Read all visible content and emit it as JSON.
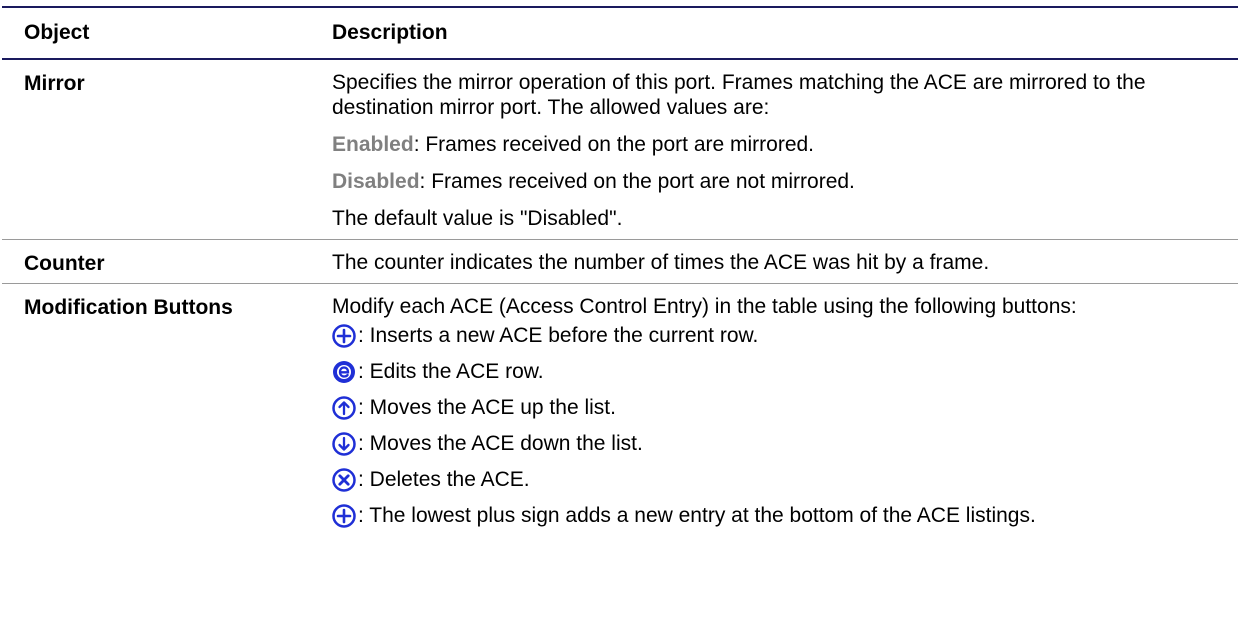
{
  "table": {
    "headers": {
      "object": "Object",
      "description": "Description"
    },
    "mirror": {
      "object": "Mirror",
      "intro": "Specifies the mirror operation of this port. Frames matching the ACE are mirrored to the destination mirror port. The allowed values are:",
      "enabled_kw": "Enabled",
      "enabled_text": ": Frames received on the port are mirrored.",
      "disabled_kw": "Disabled",
      "disabled_text": ": Frames received on the port are not mirrored.",
      "default_text": "The default value is \"Disabled\"."
    },
    "counter": {
      "object": "Counter",
      "text": "The counter indicates the number of times the ACE was hit by a frame."
    },
    "modification": {
      "object": "Modification Buttons",
      "intro": "Modify each ACE (Access Control Entry) in the table using the following buttons:",
      "buttons": [
        {
          "icon": "plus-circle-icon",
          "text": ": Inserts a new ACE before the current row."
        },
        {
          "icon": "edit-e-icon",
          "text": ": Edits the ACE row."
        },
        {
          "icon": "arrow-up-icon",
          "text": ": Moves the ACE up the list."
        },
        {
          "icon": "arrow-down-icon",
          "text": ": Moves the ACE down the list."
        },
        {
          "icon": "delete-x-icon",
          "text": ": Deletes the ACE."
        },
        {
          "icon": "plus-circle-icon",
          "text": ": The lowest plus sign adds a new entry at the bottom of the ACE listings."
        }
      ]
    }
  },
  "colors": {
    "icon_blue": "#1f2fd6",
    "keyword_gray": "#808080",
    "rule_navy": "#1a1a5e"
  }
}
